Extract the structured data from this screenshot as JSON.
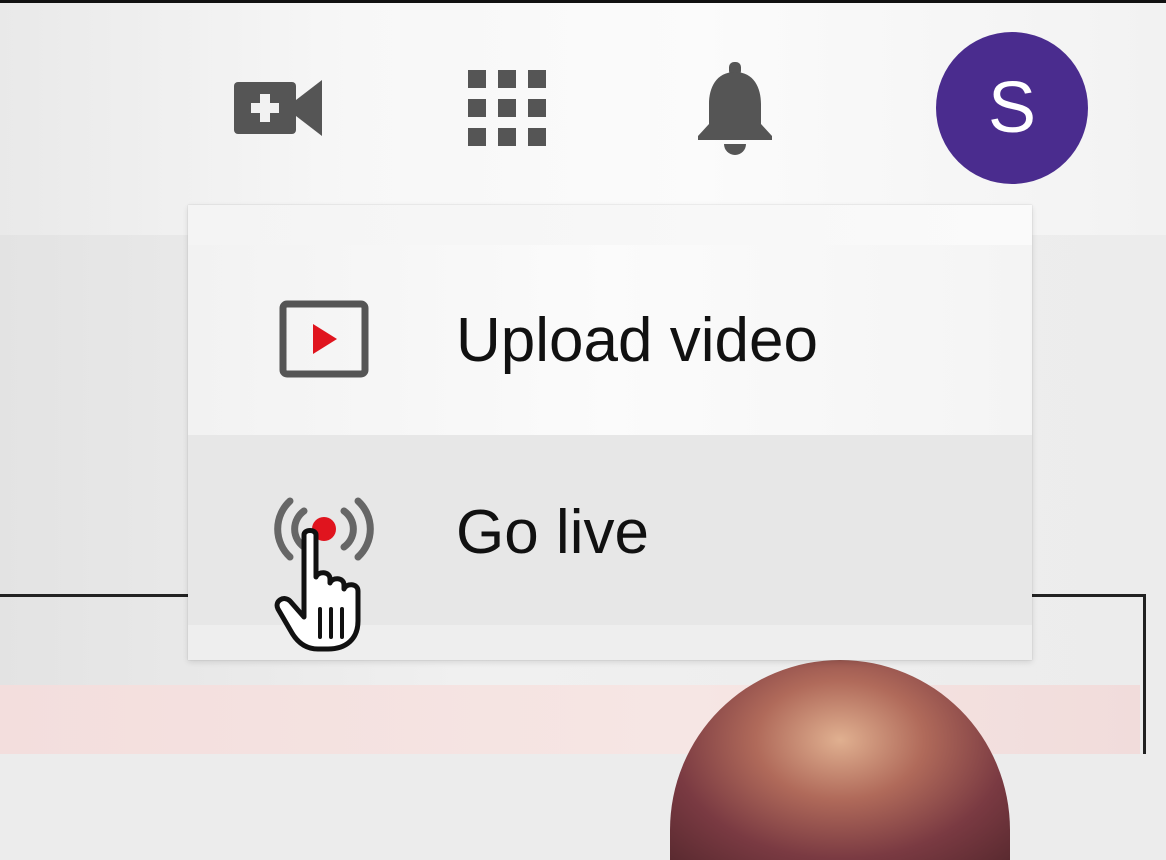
{
  "header": {
    "icons": {
      "create": "video-camera-plus-icon",
      "apps": "apps-grid-icon",
      "notifications": "bell-icon"
    },
    "avatar": {
      "initial": "S",
      "color": "#4a2c8e"
    }
  },
  "menu": {
    "items": [
      {
        "label": "Upload video",
        "icon": "play-box-icon"
      },
      {
        "label": "Go live",
        "icon": "live-broadcast-icon"
      }
    ]
  },
  "colors": {
    "accent": "#e0141e",
    "icon_gray": "#555555"
  }
}
